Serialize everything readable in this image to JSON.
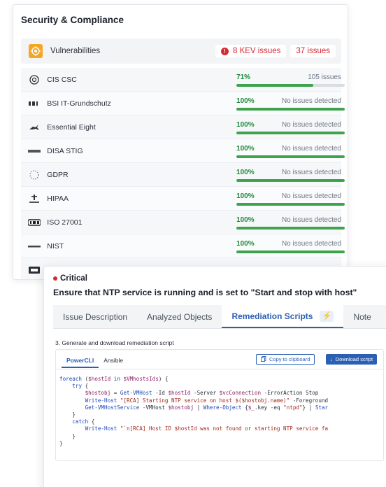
{
  "security": {
    "title": "Security & Compliance",
    "vulnerabilities": {
      "label": "Vulnerabilities",
      "kev_label": "8 KEV issues",
      "issues_label": "37 issues",
      "icon": "target-icon"
    },
    "frameworks": [
      {
        "logo": "ⓘ",
        "name": "CIS CSC",
        "percent": "71%",
        "status": "105 issues",
        "fill": 71
      },
      {
        "logo": "BSI",
        "name": "BSI IT-Grundschutz",
        "percent": "100%",
        "status": "No issues detected",
        "fill": 100
      },
      {
        "logo": "🦘",
        "name": "Essential Eight",
        "percent": "100%",
        "status": "No issues detected",
        "fill": 100
      },
      {
        "logo": "DISA",
        "name": "DISA STIG",
        "percent": "100%",
        "status": "No issues detected",
        "fill": 100
      },
      {
        "logo": "GDPR",
        "name": "GDPR",
        "percent": "100%",
        "status": "No issues detected",
        "fill": 100
      },
      {
        "logo": "HIPAA",
        "name": "HIPAA",
        "percent": "100%",
        "status": "No issues detected",
        "fill": 100
      },
      {
        "logo": "ISO",
        "name": "ISO 27001",
        "percent": "100%",
        "status": "No issues detected",
        "fill": 100
      },
      {
        "logo": "NIST",
        "name": "NIST",
        "percent": "100%",
        "status": "No issues detected",
        "fill": 100
      },
      {
        "logo": "PCI",
        "name": "",
        "percent": "",
        "status": "",
        "fill": 0
      }
    ]
  },
  "issue": {
    "severity": "Critical",
    "title": "Ensure that NTP service is running and is set to \"Start and stop with host\"",
    "tabs": [
      {
        "label": "Issue Description"
      },
      {
        "label": "Analyzed Objects"
      },
      {
        "label": "Remediation Scripts"
      },
      {
        "label": "Note"
      }
    ],
    "step_label": "3. Generate and download remediation script",
    "script_tabs": [
      "PowerCLI",
      "Ansible"
    ],
    "copy_label": "Copy to clipboard",
    "download_label": "Download script"
  }
}
